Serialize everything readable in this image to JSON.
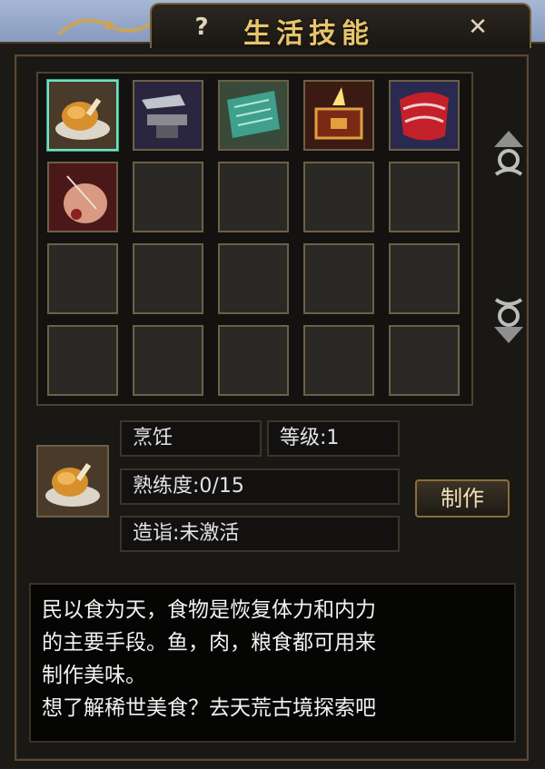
{
  "window": {
    "title": "生活技能",
    "help_label": "?",
    "close_label": "✕"
  },
  "skills": [
    {
      "name": "烹饪",
      "icon": "roast-chicken-icon"
    },
    {
      "name": "",
      "icon": "anvil-icon"
    },
    {
      "name": "",
      "icon": "scroll-map-icon"
    },
    {
      "name": "",
      "icon": "treasure-chest-icon"
    },
    {
      "name": "",
      "icon": "silk-cloth-icon"
    },
    {
      "name": "",
      "icon": "embroidery-needle-icon"
    }
  ],
  "grid": {
    "rows": 4,
    "cols": 5
  },
  "selected": {
    "name": "烹饪",
    "level_label": "等级:1",
    "proficiency_label": "熟练度:0/15",
    "mastery_label": "造诣:未激活",
    "make_button": "制作"
  },
  "description": {
    "lines": [
      "民以食为天，食物是恢复体力和内力",
      "的主要手段。鱼，肉，粮食都可用来",
      "制作美味。",
      "想了解稀世美食？去天荒古境探索吧"
    ]
  },
  "colors": {
    "accent": "#e8c46a",
    "selected_border": "#6fe3c2",
    "panel_bg": "#1c1a17"
  }
}
